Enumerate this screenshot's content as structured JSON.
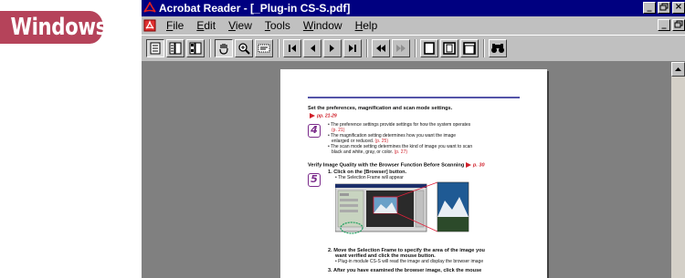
{
  "os_label": "Windows",
  "window": {
    "title": "Acrobat Reader - [_Plug-in CS-S.pdf]",
    "controls": [
      "_",
      "🗗",
      "×"
    ]
  },
  "menu": {
    "items": [
      {
        "underline": "F",
        "rest": "ile"
      },
      {
        "underline": "E",
        "rest": "dit"
      },
      {
        "underline": "V",
        "rest": "iew"
      },
      {
        "underline": "T",
        "rest": "ools"
      },
      {
        "underline": "W",
        "rest": "indow"
      },
      {
        "underline": "H",
        "rest": "elp"
      }
    ],
    "doc_controls": [
      "_",
      "🗗"
    ]
  },
  "toolbar": {
    "buttons": [
      "page-only-icon",
      "bookmarks-icon",
      "thumbnails-icon",
      "hand-tool-icon",
      "zoom-in-icon",
      "text-select-icon",
      "first-page-icon",
      "previous-page-icon",
      "next-page-icon",
      "last-page-icon",
      "go-back-icon",
      "go-forward-icon",
      "actual-size-icon",
      "fit-page-icon",
      "fit-width-icon",
      "find-icon"
    ]
  },
  "document": {
    "section1_heading": "Set the preferences, magnification and scan mode settings.",
    "section1_ref": "pp. 21-29",
    "step4_number": "4",
    "bullets1": [
      {
        "text": "• The preference settings provide settings for how the system operates",
        "ref": "(p. 21)"
      },
      {
        "text": "• The magnification setting determines how you want the image",
        "cont": "enlarged or reduced.",
        "ref": "(p. 25)"
      },
      {
        "text": "• The scan mode setting determines the kind of image you want to scan",
        "cont": "black and white, gray, or color.",
        "ref": "(p. 27)"
      }
    ],
    "section2_heading": "Verify Image Quality with the Browser Function Before Scanning",
    "section2_ref": "p. 30",
    "step5_number": "5",
    "item1_title": "1.  Click on the [Browser] button.",
    "item1_sub": "• The Selection Frame will appear",
    "item2_title": "2.  Move the Selection Frame to specify the area of the image you",
    "item2_title_cont": "want verified and click the mouse button.",
    "item2_sub": "• Plug-in module CS-S will read the image and display the browser image",
    "item3_title": "3.  After you have examined the browser image, click the mouse"
  },
  "colors": {
    "badge": "#b5435a",
    "titlebar": "#000080",
    "heading_rule": "#5454a8",
    "accent_red": "#d0202a",
    "step_purple": "#7a2a8a"
  }
}
